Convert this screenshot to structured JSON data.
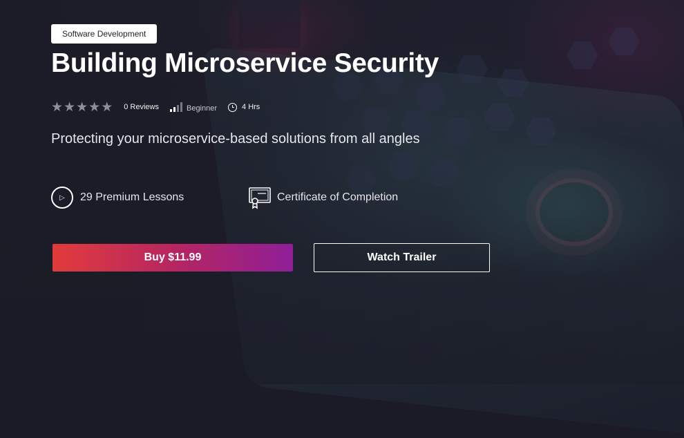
{
  "course": {
    "category": "Software Development",
    "title": "Building Microservice Security",
    "rating_stars": 5,
    "reviews": "0 Reviews",
    "level": "Beginner",
    "duration": "4 Hrs",
    "subtitle": "Protecting your microservice-based solutions from all angles",
    "features": {
      "lessons": "29 Premium Lessons",
      "certificate": "Certificate of Completion"
    }
  },
  "actions": {
    "buy_label": "Buy $11.99",
    "trailer_label": "Watch Trailer"
  },
  "colors": {
    "buy_gradient_start": "#e13b3c",
    "buy_gradient_end": "#8f1e98",
    "star_color": "#8d8f99"
  },
  "icons": {
    "star": "star-icon",
    "level": "signal-bars-icon",
    "duration": "clock-icon",
    "lessons": "play-circle-icon",
    "certificate": "certificate-icon"
  }
}
